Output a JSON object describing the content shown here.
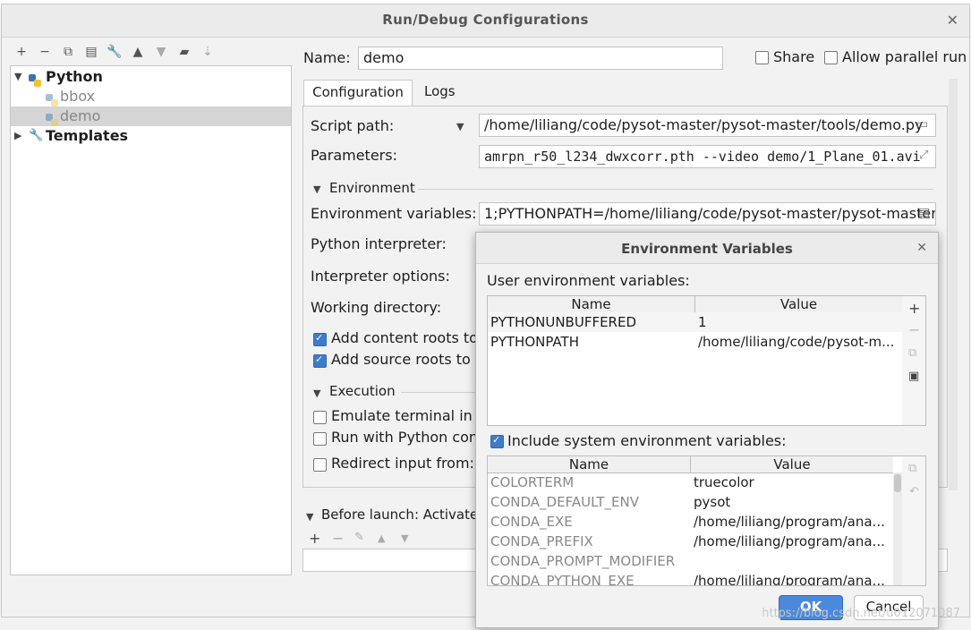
{
  "window": {
    "title": "Run/Debug Configurations"
  },
  "tree": {
    "python_label": "Python",
    "items": [
      "bbox",
      "demo"
    ],
    "templates_label": "Templates"
  },
  "form": {
    "name_label": "Name:",
    "name_value": "demo",
    "share_label": "Share",
    "parallel_label": "Allow parallel run",
    "tabs": [
      "Configuration",
      "Logs"
    ],
    "script_path_label": "Script path:",
    "script_path_value": "/home/liliang/code/pysot-master/pysot-master/tools/demo.py",
    "parameters_label": "Parameters:",
    "parameters_value": "amrpn_r50_l234_dwxcorr.pth --video demo/1_Plane_01.avi",
    "environment_section": "Environment",
    "env_vars_label": "Environment variables:",
    "env_vars_value": "1;PYTHONPATH=/home/liliang/code/pysot-master/pysot-master",
    "interpreter_label": "Python interpreter:",
    "interp_options_label": "Interpreter options:",
    "working_dir_label": "Working directory:",
    "add_content_roots": "Add content roots to",
    "add_source_roots": "Add source roots to P",
    "execution_section": "Execution",
    "emulate_terminal": "Emulate terminal in o",
    "run_python_console": "Run with Python cons",
    "redirect_input": "Redirect input from:",
    "before_launch": "Before launch: Activate"
  },
  "env_dialog": {
    "title": "Environment Variables",
    "user_vars_label": "User environment variables:",
    "col_name": "Name",
    "col_value": "Value",
    "user_vars": [
      {
        "name": "PYTHONUNBUFFERED",
        "value": "1"
      },
      {
        "name": "PYTHONPATH",
        "value": "/home/liliang/code/pysot-m..."
      }
    ],
    "include_system_label": "Include system environment variables:",
    "system_vars": [
      {
        "name": "COLORTERM",
        "value": "truecolor"
      },
      {
        "name": "CONDA_DEFAULT_ENV",
        "value": "pysot"
      },
      {
        "name": "CONDA_EXE",
        "value": "/home/liliang/program/ana..."
      },
      {
        "name": "CONDA_PREFIX",
        "value": "/home/liliang/program/ana..."
      },
      {
        "name": "CONDA_PROMPT_MODIFIER",
        "value": ""
      },
      {
        "name": "CONDA_PYTHON_EXE",
        "value": "/home/liliang/program/ana..."
      }
    ],
    "ok_label": "OK",
    "cancel_label": "Cancel"
  },
  "watermark": "https://blog.csdn.net/u012071087",
  "colors": {
    "accent": "#4a89dc",
    "selected_row": "#d5d5d5",
    "checkbox": "#3d7cc9"
  }
}
